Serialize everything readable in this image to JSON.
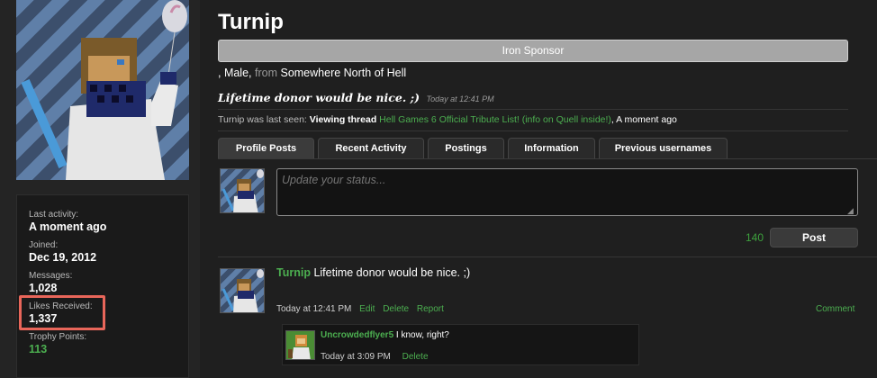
{
  "profile": {
    "username": "Turnip",
    "banner": "Iron Sponsor",
    "gender_prefix": ", Male,",
    "from_label": "from",
    "location": "Somewhere North of Hell",
    "status_text": "Lifetime donor would be nice. ;)",
    "status_time": "Today at 12:41 PM"
  },
  "last_seen": {
    "prefix": "Turnip was last seen:",
    "action": "Viewing thread",
    "thread": "Hell Games 6 Official Tribute List! (info on Quell inside!)",
    "when": ", A moment ago"
  },
  "stats": [
    {
      "label": "Last activity:",
      "value": "A moment ago"
    },
    {
      "label": "Joined:",
      "value": "Dec 19, 2012"
    },
    {
      "label": "Messages:",
      "value": "1,028"
    },
    {
      "label": "Likes Received:",
      "value": "1,337"
    },
    {
      "label": "Trophy Points:",
      "value": "113"
    }
  ],
  "tabs": [
    "Profile Posts",
    "Recent Activity",
    "Postings",
    "Information",
    "Previous usernames"
  ],
  "status_update": {
    "placeholder": "Update your status...",
    "counter": "140",
    "post_label": "Post"
  },
  "post": {
    "author": "Turnip",
    "text": "Lifetime donor would be nice. ;)",
    "time": "Today at 12:41 PM",
    "edit": "Edit",
    "delete": "Delete",
    "report": "Report",
    "comment": "Comment"
  },
  "comment": {
    "author": "Uncrowdedflyer5",
    "text": "I know, right?",
    "time": "Today at 3:09 PM",
    "delete": "Delete"
  },
  "colors": {
    "accent": "#4caf50",
    "banner": "#a6a6a6",
    "highlight": "#e8665a"
  }
}
